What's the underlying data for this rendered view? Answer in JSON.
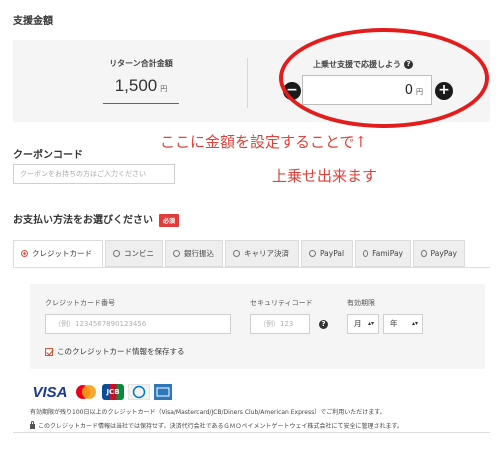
{
  "support": {
    "section_title": "支援金額",
    "total_label": "リターン合計金額",
    "total_value": "1,500",
    "total_unit": "円",
    "extra_label": "上乗せ支援で応援しよう",
    "extra_value": "0",
    "extra_unit": "円"
  },
  "annotation": {
    "line1": "ここに金額を設定することで↑",
    "line2": "上乗せ出来ます",
    "color": "#e31c1c"
  },
  "coupon": {
    "title": "クーポンコード",
    "placeholder": "クーポンをお持ちの方はご入力ください"
  },
  "payment": {
    "title": "お支払い方法をお選びください",
    "required_badge": "必須",
    "tabs": [
      {
        "label": "クレジットカード",
        "active": true
      },
      {
        "label": "コンビニ"
      },
      {
        "label": "銀行振込"
      },
      {
        "label": "キャリア決済"
      },
      {
        "label": "PayPal"
      },
      {
        "label": "FamiPay"
      },
      {
        "label": "PayPay"
      }
    ]
  },
  "card": {
    "number_label": "クレジットカード番号",
    "number_placeholder": "（例）1234567890123456",
    "security_label": "セキュリティコード",
    "security_placeholder": "（例）123",
    "expiry_label": "有効期限",
    "month_select": "月",
    "year_select": "年",
    "save_checkbox_label": "このクレジットカード情報を保存する"
  },
  "brands": {
    "visa": "VISA",
    "jcb": "JCB"
  },
  "notes": {
    "validity": "有効期限が残り100日以上のクレジットカード（Visa/Mastercard/JCB/Diners Club/American Express）でご利用いただけます。",
    "security": "このクレジットカード情報は当社では保持せず、決済代行会社であるＧＭＯペイメントゲートウェイ株式会社にて安全に管理されます。"
  }
}
